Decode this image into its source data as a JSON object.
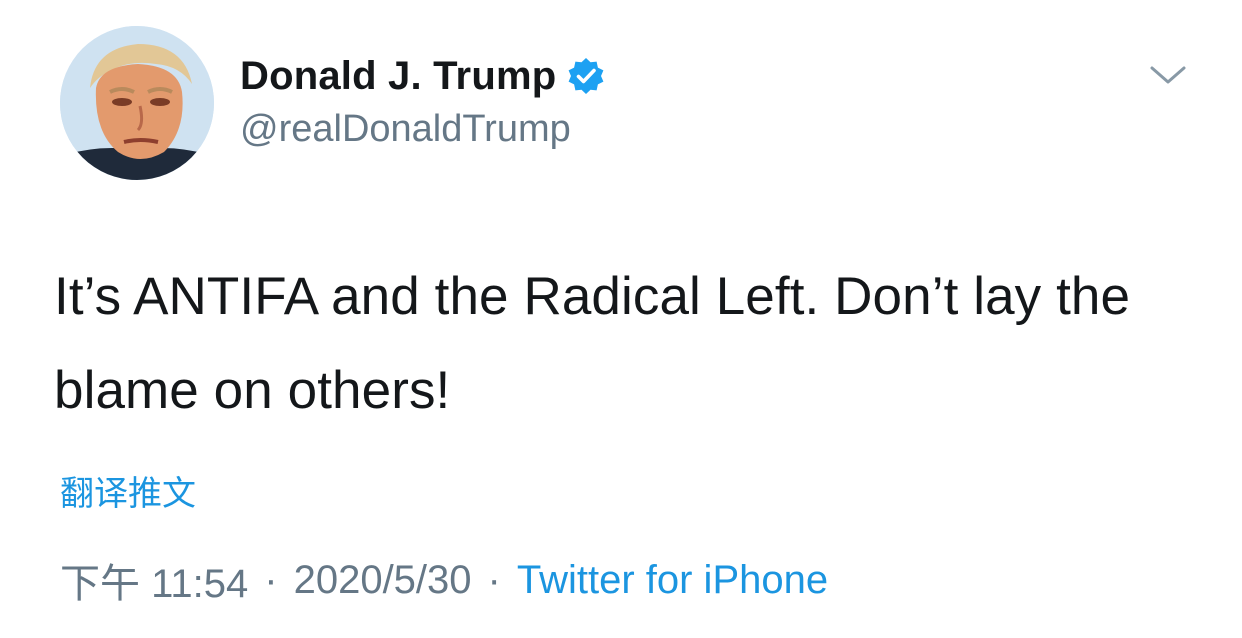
{
  "author": {
    "display_name": "Donald J. Trump",
    "handle": "@realDonaldTrump",
    "verified": true,
    "avatar_icon": "profile-photo"
  },
  "tweet": {
    "text": "It’s ANTIFA and the Radical Left. Don’t lay the blame on others!",
    "translate_label": "翻译推文"
  },
  "meta": {
    "time": "下午 11:54",
    "separator": "·",
    "date": "2020/5/30",
    "source": "Twitter for iPhone"
  },
  "colors": {
    "accent": "#1b95e0",
    "secondary_text": "#657786",
    "primary_text": "#14171a",
    "verified_badge": "#1da1f2"
  },
  "icons": {
    "menu": "chevron-down-icon",
    "verified": "verified-badge-icon"
  }
}
